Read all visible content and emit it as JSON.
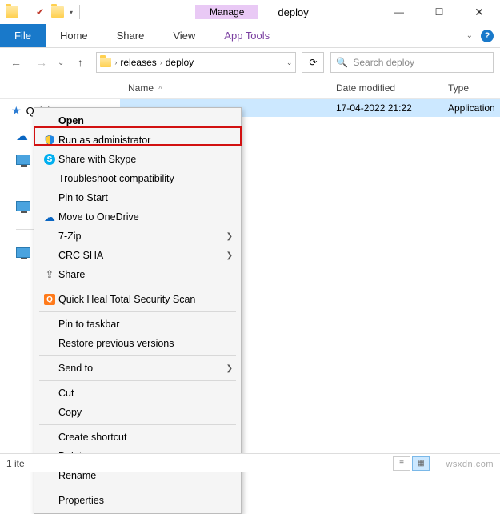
{
  "title_tab_contextual": "Manage",
  "window_title": "deploy",
  "ribbon": {
    "file": "File",
    "home": "Home",
    "share": "Share",
    "view": "View",
    "app_tools": "App Tools"
  },
  "breadcrumbs": {
    "a": "releases",
    "b": "deploy"
  },
  "search_placeholder": "Search deploy",
  "columns": {
    "name": "Name",
    "date": "Date modified",
    "type": "Type"
  },
  "sidebar": {
    "quick_access": "Quick access"
  },
  "file_row": {
    "date": "17-04-2022 21:22",
    "type": "Application"
  },
  "context_menu": {
    "open": "Open",
    "run_admin": "Run as administrator",
    "share_skype": "Share with Skype",
    "troubleshoot": "Troubleshoot compatibility",
    "pin_start": "Pin to Start",
    "move_onedrive": "Move to OneDrive",
    "sevenzip": "7-Zip",
    "crc_sha": "CRC SHA",
    "share": "Share",
    "quickheal": "Quick Heal Total Security Scan",
    "pin_taskbar": "Pin to taskbar",
    "restore_prev": "Restore previous versions",
    "send_to": "Send to",
    "cut": "Cut",
    "copy": "Copy",
    "create_shortcut": "Create shortcut",
    "delete": "Delete",
    "rename": "Rename",
    "properties": "Properties"
  },
  "status": {
    "items": "1 ite"
  },
  "watermark": "wsxdn.com"
}
